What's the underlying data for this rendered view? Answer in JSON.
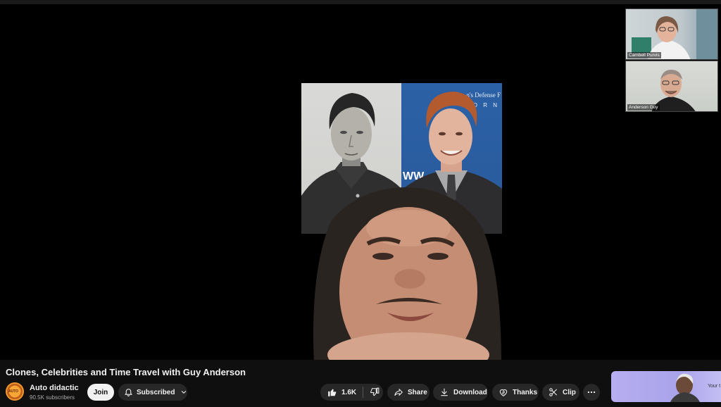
{
  "video": {
    "title": "Clones, Celebrities and Time Travel with Guy Anderson"
  },
  "channel": {
    "name": "Auto didactic",
    "subscribers": "90.5K subscribers",
    "avatar_icon": "channel-logo-icon"
  },
  "buttons": {
    "join": "Join",
    "subscribed": "Subscribed",
    "likes": "1.6K",
    "share": "Share",
    "download": "Download",
    "thanks": "Thanks",
    "clip": "Clip"
  },
  "participants": [
    {
      "name": "Cambell Purvis"
    },
    {
      "name": "Anderson Guy"
    }
  ],
  "photo": {
    "banner_line1": "n's Defense F",
    "banner_line2": "O R N",
    "banner_www": "WW"
  },
  "ad": {
    "text": "Your t"
  },
  "colors": {
    "background": "#0f0f0f",
    "button_bg": "#272727",
    "text": "#f1f1f1",
    "muted_text": "#aaaaaa"
  }
}
